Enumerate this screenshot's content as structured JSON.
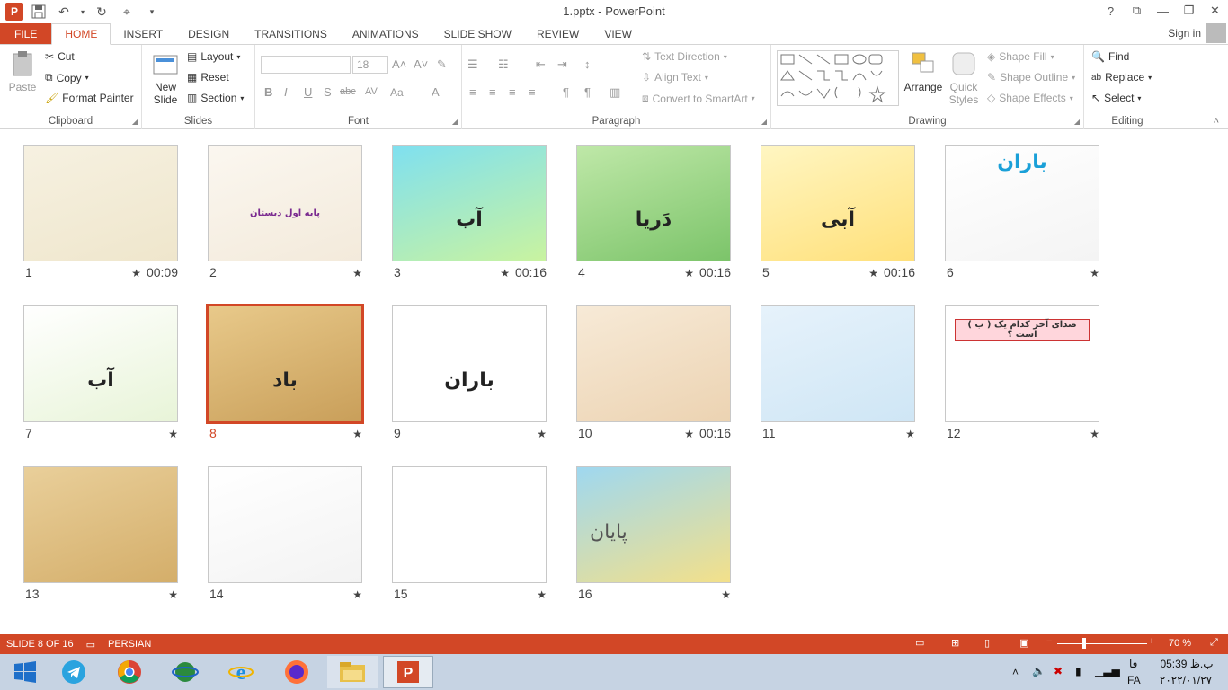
{
  "window": {
    "title": "1.pptx - PowerPoint",
    "help": "?",
    "signin": "Sign in"
  },
  "tabs": [
    "FILE",
    "HOME",
    "INSERT",
    "DESIGN",
    "TRANSITIONS",
    "ANIMATIONS",
    "SLIDE SHOW",
    "REVIEW",
    "VIEW"
  ],
  "ribbon": {
    "clipboard": {
      "label": "Clipboard",
      "paste": "Paste",
      "cut": "Cut",
      "copy": "Copy",
      "format_painter": "Format Painter"
    },
    "slides": {
      "label": "Slides",
      "new_slide": "New Slide",
      "layout": "Layout",
      "reset": "Reset",
      "section": "Section"
    },
    "font": {
      "label": "Font",
      "font_size": "18",
      "buttons": [
        "B",
        "I",
        "U",
        "S",
        "abc",
        "AV",
        "Aa",
        "A"
      ]
    },
    "paragraph": {
      "label": "Paragraph",
      "text_direction": "Text Direction",
      "align_text": "Align Text",
      "convert_smartart": "Convert to SmartArt"
    },
    "drawing": {
      "label": "Drawing",
      "arrange": "Arrange",
      "quick_styles": "Quick Styles",
      "shape_fill": "Shape Fill",
      "shape_outline": "Shape Outline",
      "shape_effects": "Shape Effects"
    },
    "editing": {
      "label": "Editing",
      "find": "Find",
      "replace": "Replace",
      "select": "Select"
    }
  },
  "slides": [
    {
      "num": "1",
      "timing": "00:09",
      "text": "",
      "colors": [
        "#f6f1e1",
        "#efe6cc"
      ]
    },
    {
      "num": "2",
      "timing": "",
      "text": "پایه اول دبستان",
      "colors": [
        "#fbf7f0",
        "#f3eadb"
      ]
    },
    {
      "num": "3",
      "timing": "00:16",
      "text": "آب",
      "colors": [
        "#7fe0f0",
        "#c9f3a0"
      ]
    },
    {
      "num": "4",
      "timing": "00:16",
      "text": "دَریا",
      "colors": [
        "#bfe8a8",
        "#7cc46a"
      ]
    },
    {
      "num": "5",
      "timing": "00:16",
      "text": "آبی",
      "colors": [
        "#fff6c2",
        "#ffe07a"
      ]
    },
    {
      "num": "6",
      "timing": "",
      "text": "باران",
      "colors": [
        "#ffffff",
        "#f4f4f4"
      ]
    },
    {
      "num": "7",
      "timing": "",
      "text": "آب",
      "colors": [
        "#ffffff",
        "#e8f4d8"
      ]
    },
    {
      "num": "8",
      "timing": "",
      "text": "باد",
      "colors": [
        "#e8c98a",
        "#c99f5a"
      ]
    },
    {
      "num": "9",
      "timing": "",
      "text": "باران",
      "colors": [
        "#ffffff",
        "#ffffff"
      ]
    },
    {
      "num": "10",
      "timing": "00:16",
      "text": "",
      "colors": [
        "#f7ead7",
        "#ecd3b2"
      ]
    },
    {
      "num": "11",
      "timing": "",
      "text": "",
      "colors": [
        "#e6f2fb",
        "#cfe6f5"
      ]
    },
    {
      "num": "12",
      "timing": "",
      "text": "صدای آخر کدام یک ( ب ) است ؟",
      "colors": [
        "#ffffff",
        "#ffffff"
      ]
    },
    {
      "num": "13",
      "timing": "",
      "text": "",
      "colors": [
        "#e9cf9a",
        "#d4ae6a"
      ]
    },
    {
      "num": "14",
      "timing": "",
      "text": "",
      "colors": [
        "#ffffff",
        "#f3f3f3"
      ]
    },
    {
      "num": "15",
      "timing": "",
      "text": "",
      "colors": [
        "#ffffff",
        "#ffffff"
      ]
    },
    {
      "num": "16",
      "timing": "",
      "text": "پایان",
      "colors": [
        "#9fd8f0",
        "#f3e08a"
      ]
    }
  ],
  "status": {
    "slide_info": "SLIDE 8 OF 16",
    "language": "PERSIAN",
    "zoom": "70 %"
  },
  "taskbar": {
    "time": "05:39 ب.ظ",
    "date": "۲۰۲۲/۰۱/۲۷",
    "lang": "FA",
    "lang2": "فا"
  },
  "accent": "#d24726"
}
